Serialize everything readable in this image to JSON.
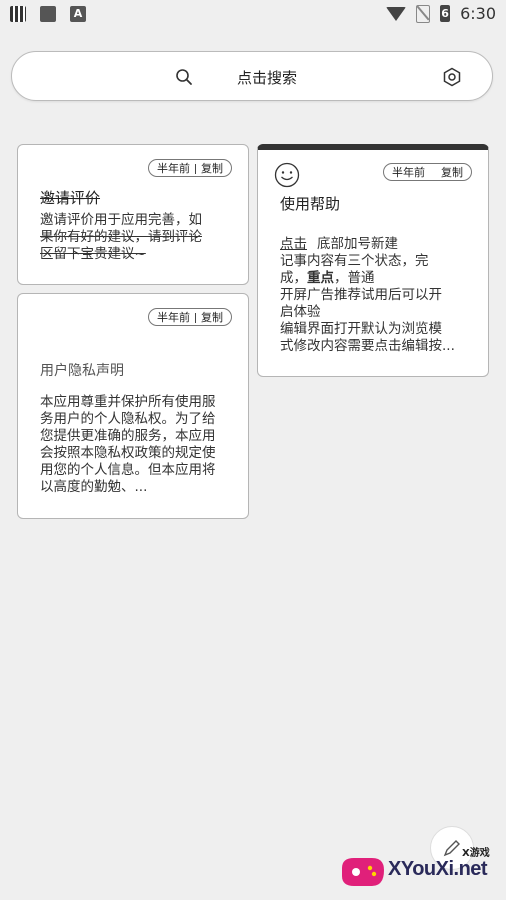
{
  "status_bar": {
    "time": "6:30",
    "battery_level": "6",
    "left_icons": [
      "qr-code-icon",
      "image-icon",
      "text-a-icon"
    ],
    "right_icons": [
      "wifi-icon",
      "no-sim-icon",
      "battery-icon"
    ]
  },
  "search": {
    "label": "点击搜索",
    "left_icon": "search-icon",
    "right_icon": "settings-hexagon-icon"
  },
  "notes": [
    {
      "meta": "半年前",
      "copy": "复制",
      "title": "邀请评价",
      "body_line1": "邀请评价用于应用完善，如",
      "body_line2": "果你有好的建议，请到评论",
      "body_line3": "区留下宝贵建议~"
    },
    {
      "meta": "半年前",
      "copy": "复制",
      "title": "用户隐私声明",
      "body": "本应用尊重并保护所有使用服务用户的个人隐私权。为了给您提供更准确的服务，本应用会按照本隐私权政策的规定使用您的个人信息。但本应用将以高度的勤勉、..."
    },
    {
      "meta": "半年前",
      "copy": "复制",
      "title": "使用帮助",
      "body_click": "点击",
      "body_line1_rest": "底部加号新建",
      "body_line2": "记事内容有三个状态，完",
      "body_line3_a": "成，",
      "body_line3_b": "重点",
      "body_line3_c": "，普通",
      "body_line4": "开屏广告推荐试用后可以开",
      "body_line5": "启体验",
      "body_line6": "编辑界面打开默认为浏览模",
      "body_line7": "式修改内容需要点击编辑按..."
    }
  ],
  "watermark": {
    "brand": "XYouXi.net",
    "sub": "X游戏"
  }
}
